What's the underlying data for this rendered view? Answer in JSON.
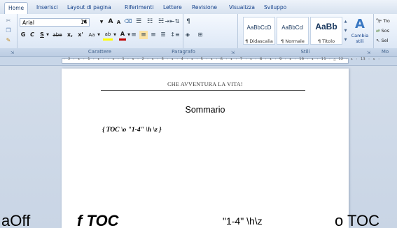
{
  "tabs": [
    "Home",
    "Inserisci",
    "Layout di pagina",
    "Riferimenti",
    "Lettere",
    "Revisione",
    "Visualizza",
    "Sviluppo"
  ],
  "font": {
    "name": "Arial",
    "size": "14",
    "bold_label": "G",
    "italic_label": "C",
    "underline_label": "S",
    "strike_label": "abe",
    "subscript_label": "x,",
    "superscript_label": "x'",
    "case_label": "Aa",
    "grow_label": "A",
    "shrink_label": "A",
    "highlight_label": "ab",
    "color_label": "A"
  },
  "groups": {
    "clipboard": "",
    "font": "Carattere",
    "paragraph": "Paragrafo",
    "styles": "Stili",
    "editing": "Mo"
  },
  "styles": [
    {
      "preview": "AaBbCcD",
      "name": "¶ Didascalia"
    },
    {
      "preview": "AaBbCcI",
      "name": "¶ Normale"
    },
    {
      "preview": "AaBb",
      "name": "¶ Titolo"
    }
  ],
  "change_styles": "Cambia stili",
  "editing": {
    "find": "Tro",
    "replace": "Sos",
    "select": "Sel"
  },
  "ruler": "· 2 · ı · 1 · ı ·   · ı · 1 · ı · 2 · ı · 3 · ı · 4 · ı · 5 · ı · 6 · ı · 7 · ı · 8 · ı · 9 · ı · 10 · ı · 11 · △ 12 · ı · 13 · ı ·",
  "document": {
    "header": "CHE AVVENTURA  LA VITA!",
    "title": "Sommario",
    "toc_field": "{ TOC \\o \"1-4\" \\h \\z }"
  },
  "ghost": {
    "part1": "aOff",
    "part2": "f TOC",
    "part3": "\"1-4\" \\h\\z",
    "part4": "o TOC"
  },
  "colors": {
    "highlight": "#ffff00",
    "font_color": "#c00000",
    "ribbon_text": "#15428b"
  }
}
